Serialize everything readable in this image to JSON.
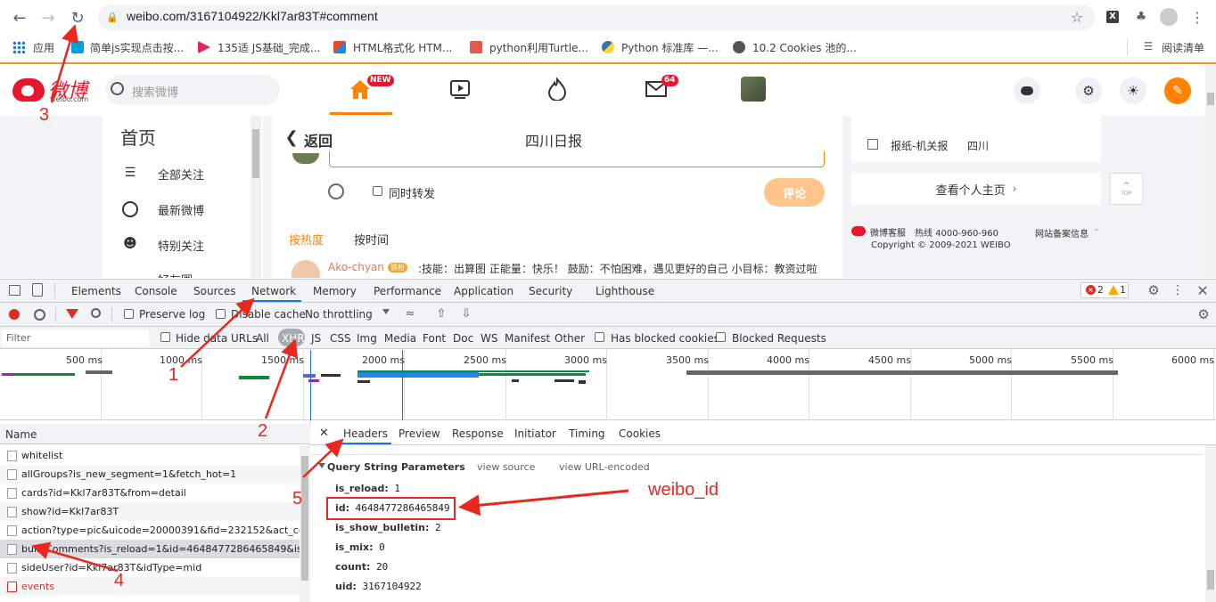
{
  "browser": {
    "url": "weibo.com/3167104922/Kkl7ar83T#comment",
    "bookmarks": [
      "应用",
      "简单js实现点击按...",
      "135适 JS基础_完成...",
      "HTML格式化 HTM...",
      "python利用Turtle...",
      "Python 标准库 —...",
      "10.2 Cookies 池的..."
    ],
    "reading_list": "阅读清单"
  },
  "weibo": {
    "logo_text": "微博",
    "logo_sub": "weibo.com",
    "search_placeholder": "搜索微博",
    "badge_new": "NEW",
    "badge_msg": "64",
    "sidebar": {
      "title": "首页",
      "items": [
        "全部关注",
        "最新微博",
        "特别关注",
        "好友圈"
      ]
    },
    "center": {
      "back": "返回",
      "title": "四川日报",
      "forward_label": "同时转发",
      "comment_btn": "评论",
      "sort_hot": "按热度",
      "sort_time": "按时间",
      "comment_user": "Ako-chyan",
      "comment_badge": "铁粉",
      "comment_text": ":技能：出算图 正能量：快乐！ 鼓励：不怕困难，遇见更好的自己 小目标：教资过啦"
    },
    "right": {
      "tag1": "报纸-机关报",
      "tag2": "四川",
      "profile_btn": "查看个人主页",
      "top_label": "TOP",
      "service": "微博客服",
      "hotline": "热线 4000-960-960",
      "icp": "网站备案信息",
      "copyright": "Copyright © 2009-2021 WEIBO"
    }
  },
  "devtools": {
    "tabs": [
      "Elements",
      "Console",
      "Sources",
      "Network",
      "Memory",
      "Performance",
      "Application",
      "Security",
      "Lighthouse"
    ],
    "active_tab": "Network",
    "errors": "2",
    "warnings": "1",
    "toolbar": {
      "preserve_log": "Preserve log",
      "disable_cache": "Disable cache",
      "throttling": "No throttling"
    },
    "filter": {
      "placeholder": "Filter",
      "hide_data_urls": "Hide data URLs",
      "types": [
        "All",
        "XHR",
        "JS",
        "CSS",
        "Img",
        "Media",
        "Font",
        "Doc",
        "WS",
        "Manifest",
        "Other"
      ],
      "active_type": "XHR",
      "blocked_cookies": "Has blocked cookies",
      "blocked_requests": "Blocked Requests"
    },
    "timeline_ticks": [
      "500 ms",
      "1000 ms",
      "1500 ms",
      "2000 ms",
      "2500 ms",
      "3000 ms",
      "3500 ms",
      "4000 ms",
      "4500 ms",
      "5000 ms",
      "5500 ms",
      "6000 ms"
    ],
    "name_header": "Name",
    "requests": [
      "whitelist",
      "allGroups?is_new_segment=1&fetch_hot=1",
      "cards?id=Kkl7ar83T&from=detail",
      "show?id=Kkl7ar83T",
      "action?type=pic&uicode=20000391&fid=232152&act_coc",
      "buildComments?is_reload=1&id=4648477286465849&is_s",
      "sideUser?id=Kkl7ar83T&idType=mid",
      "events"
    ],
    "detail_tabs": [
      "Headers",
      "Preview",
      "Response",
      "Initiator",
      "Timing",
      "Cookies"
    ],
    "active_detail_tab": "Headers",
    "query_section": "Query String Parameters",
    "view_source": "view source",
    "view_url_encoded": "view URL-encoded",
    "params": [
      {
        "key": "is_reload:",
        "value": "1"
      },
      {
        "key": "id:",
        "value": "4648477286465849"
      },
      {
        "key": "is_show_bulletin:",
        "value": "2"
      },
      {
        "key": "is_mix:",
        "value": "0"
      },
      {
        "key": "count:",
        "value": "20"
      },
      {
        "key": "uid:",
        "value": "3167104922"
      }
    ]
  },
  "annotations": {
    "n1": "1",
    "n2": "2",
    "n3": "3",
    "n4": "4",
    "n5": "5",
    "label": "weibo_id"
  },
  "colors": {
    "annotation": "#e8281e",
    "weibo_orange": "#ff8200",
    "devtools_blue": "#1a73e8"
  }
}
